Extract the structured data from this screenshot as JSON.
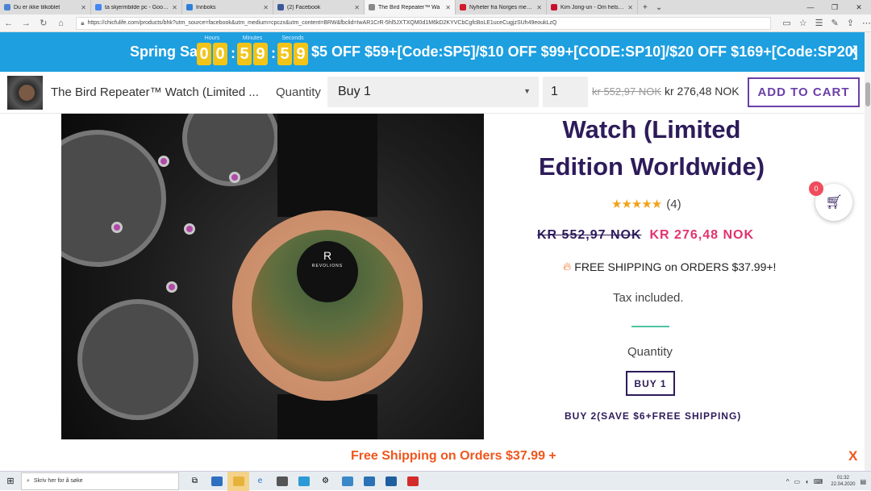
{
  "browser": {
    "tabs": [
      {
        "title": "Du er ikke tilkoblet",
        "color": "#4b84d6",
        "active": false
      },
      {
        "title": "ta skjermbilde pc - Google-",
        "color": "#4285f4",
        "active": false
      },
      {
        "title": "Innboks",
        "color": "#2d7fd8",
        "active": false
      },
      {
        "title": "(2) Facebook",
        "color": "#3b5998",
        "active": false
      },
      {
        "title": "The Bird Repeater™ Wa",
        "color": "#888888",
        "active": true
      },
      {
        "title": "Nyheter fra Norges mest les",
        "color": "#d11a2a",
        "active": false
      },
      {
        "title": "Kim Jong-un - Om helseryk",
        "color": "#c8102e",
        "active": false
      }
    ],
    "url": "https://chicfulife.com/products/bhk?utm_source=facebook&utm_medium=cpczx&utm_content=BRW&fbclid=IwAR1CrR-5hl5JXTXQM0d1M6kD2KYVCbCgfcBoLE1uceCugjzSUh49eoukLzQ"
  },
  "sale_banner": {
    "title": "Spring Sale",
    "timer": {
      "hours_label": "Hours",
      "minutes_label": "Minutes",
      "seconds_label": "Seconds",
      "h1": "0",
      "h2": "0",
      "m1": "5",
      "m2": "9",
      "s1": "5",
      "s2": "9"
    },
    "deal_text": "$5 OFF $59+[Code:SP5]/$10 OFF $99+[CODE:SP10]/$20 OFF $169+[Code:SP20]",
    "close": "X",
    "color": "#1d9fe0"
  },
  "sticky_bar": {
    "product_name": "The Bird Repeater™ Watch (Limited ...",
    "quantity_label": "Quantity",
    "select_value": "Buy 1",
    "qty_value": "1",
    "old_price": "kr 552,97 NOK",
    "new_price": "kr 276,48 NOK",
    "add_to_cart": "ADD TO CART"
  },
  "product": {
    "title_line1": "Watch (Limited",
    "title_line2": "Edition Worldwide)",
    "stars": "★★★★★",
    "review_count": "(4)",
    "old_price": "KR 552,97 NOK",
    "new_price": "KR 276,48 NOK",
    "shipping": "FREE SHIPPING on ORDERS $37.99+!",
    "tax": "Tax included.",
    "quantity_label": "Quantity",
    "option1": "BUY 1",
    "option2": "BUY 2(SAVE $6+FREE SHIPPING)",
    "watch_brand_letter": "R",
    "watch_brand": "REVOLIONS"
  },
  "cart": {
    "count": "0"
  },
  "footer_banner": {
    "text": "Free Shipping on Orders $37.99 +",
    "close": "X"
  },
  "taskbar": {
    "search_placeholder": "Skriv her for å søke",
    "time": "01:32",
    "date": "22.04.2020"
  },
  "colors": {
    "accent_purple": "#2d1b5a",
    "price_pink": "#e3326f",
    "button_purple": "#6b3fa8",
    "orange": "#f0561d"
  }
}
